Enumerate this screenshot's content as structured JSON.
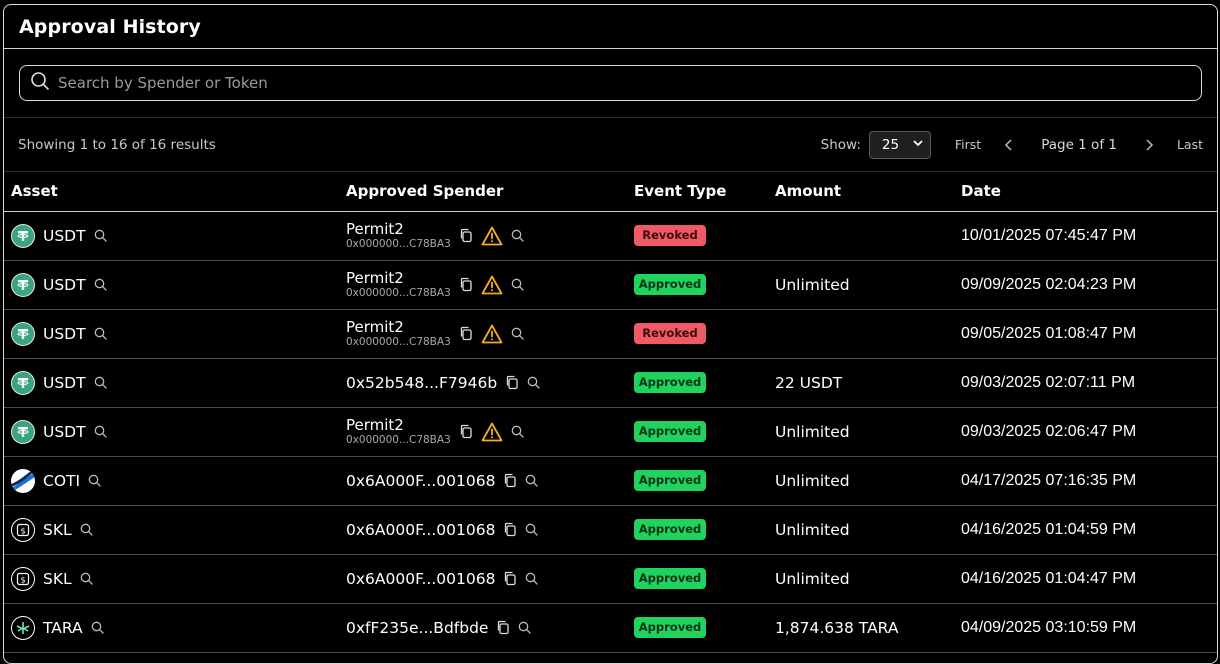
{
  "title": "Approval History",
  "search": {
    "placeholder": "Search by Spender or Token"
  },
  "pagination": {
    "results_text": "Showing 1 to 16 of 16 results",
    "show_label": "Show:",
    "page_size": "25",
    "first_label": "First",
    "page_info": "Page 1 of 1",
    "last_label": "Last"
  },
  "columns": {
    "asset": "Asset",
    "spender": "Approved Spender",
    "event": "Event Type",
    "amount": "Amount",
    "date": "Date"
  },
  "colors": {
    "approved": "#1fd35e",
    "revoked": "#f05a64",
    "warning": "#f2b01e",
    "usdt": "#3aa37f"
  },
  "rows": [
    {
      "asset": "USDT",
      "icon": "usdt",
      "spender_name": "Permit2",
      "spender_addr": "0x000000...C78BA3",
      "warn": true,
      "event": "Revoked",
      "amount": "",
      "date": "10/01/2025 07:45:47 PM"
    },
    {
      "asset": "USDT",
      "icon": "usdt",
      "spender_name": "Permit2",
      "spender_addr": "0x000000...C78BA3",
      "warn": true,
      "event": "Approved",
      "amount": "Unlimited",
      "date": "09/09/2025 02:04:23 PM"
    },
    {
      "asset": "USDT",
      "icon": "usdt",
      "spender_name": "Permit2",
      "spender_addr": "0x000000...C78BA3",
      "warn": true,
      "event": "Revoked",
      "amount": "",
      "date": "09/05/2025 01:08:47 PM"
    },
    {
      "asset": "USDT",
      "icon": "usdt",
      "spender_name": "",
      "spender_addr": "0x52b548...F7946b",
      "warn": false,
      "event": "Approved",
      "amount": "22 USDT",
      "date": "09/03/2025 02:07:11 PM"
    },
    {
      "asset": "USDT",
      "icon": "usdt",
      "spender_name": "Permit2",
      "spender_addr": "0x000000...C78BA3",
      "warn": true,
      "event": "Approved",
      "amount": "Unlimited",
      "date": "09/03/2025 02:06:47 PM"
    },
    {
      "asset": "COTI",
      "icon": "coti",
      "spender_name": "",
      "spender_addr": "0x6A000F...001068",
      "warn": false,
      "event": "Approved",
      "amount": "Unlimited",
      "date": "04/17/2025 07:16:35 PM"
    },
    {
      "asset": "SKL",
      "icon": "skl",
      "spender_name": "",
      "spender_addr": "0x6A000F...001068",
      "warn": false,
      "event": "Approved",
      "amount": "Unlimited",
      "date": "04/16/2025 01:04:59 PM"
    },
    {
      "asset": "SKL",
      "icon": "skl",
      "spender_name": "",
      "spender_addr": "0x6A000F...001068",
      "warn": false,
      "event": "Approved",
      "amount": "Unlimited",
      "date": "04/16/2025 01:04:47 PM"
    },
    {
      "asset": "TARA",
      "icon": "tara",
      "spender_name": "",
      "spender_addr": "0xfF235e...Bdfbde",
      "warn": false,
      "event": "Approved",
      "amount": "1,874.638 TARA",
      "date": "04/09/2025 03:10:59 PM"
    }
  ]
}
